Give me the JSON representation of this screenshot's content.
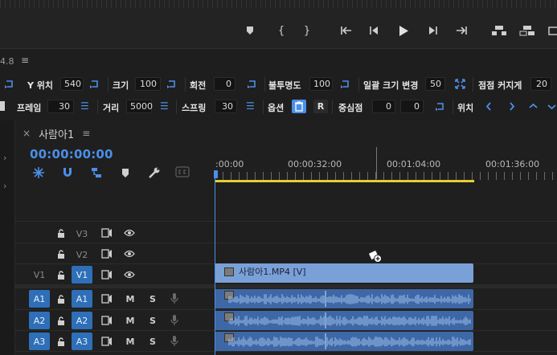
{
  "panel_version": "4.8",
  "props_row1": {
    "y_pos_label": "Y 위치",
    "y_pos_value": "540",
    "size_label": "크기",
    "size_value": "100",
    "rotation_label": "회전",
    "rotation_value": "0",
    "opacity_label": "불투명도",
    "opacity_value": "100",
    "uniform_scale_label": "일괄 크기 변경",
    "uniform_scale_value": "50",
    "point_label": "점점 커지게",
    "point_value": "20"
  },
  "props_row2": {
    "frames_label": "프레임",
    "frames_value": "30",
    "distance_label": "거리",
    "distance_value": "5000",
    "spring_label": "스프링",
    "spring_value": "30",
    "options_label": "옵션",
    "option_r": "R",
    "anchor_label": "중심점",
    "anchor_x": "0",
    "anchor_y": "0",
    "position_label": "위치"
  },
  "sequence": {
    "close_glyph": "×",
    "name": "사람아1",
    "menu_glyph": "≡"
  },
  "timecode": "00:00:00:00",
  "ruler": {
    "labels": [
      ":00:00",
      "00:00:32:00",
      "00:01:04:00",
      "00:01:36:00"
    ]
  },
  "tracks": {
    "v3": "V3",
    "v2": "V2",
    "v1_src": "V1",
    "v1": "V1",
    "a1_src": "A1",
    "a1": "A1",
    "a2_src": "A2",
    "a2": "A2",
    "a3_src": "A3",
    "a3": "A3",
    "m": "M",
    "s": "S"
  },
  "clips": {
    "video_title": "사람아1.MP4 [V]"
  },
  "colors": {
    "accent": "#4b8fe8",
    "selected_track": "#2e6fb7",
    "video_clip": "#7aa0d8",
    "audio_clip": "#3e67a6",
    "work_area": "#e3d02f"
  }
}
